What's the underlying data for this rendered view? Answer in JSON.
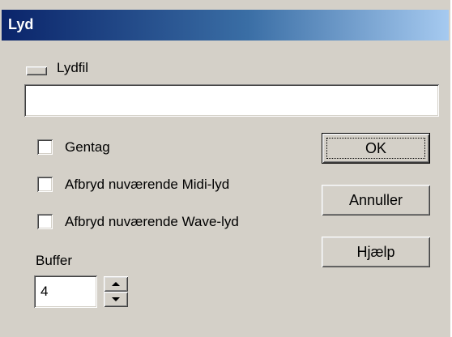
{
  "window": {
    "title": "Lyd"
  },
  "sound_file": {
    "label": "Lydfil",
    "value": "",
    "placeholder": ""
  },
  "options": {
    "repeat": {
      "label": "Gentag",
      "checked": false
    },
    "stop_midi": {
      "label": "Afbryd nuværende Midi-lyd",
      "checked": false
    },
    "stop_wave": {
      "label": "Afbryd nuværende Wave-lyd",
      "checked": false
    }
  },
  "buffer": {
    "label": "Buffer",
    "value": "4"
  },
  "buttons": {
    "ok": "OK",
    "cancel": "Annuller",
    "help": "Hjælp"
  },
  "colors": {
    "face": "#d4d0c8",
    "title_start": "#0a246a",
    "title_end": "#a6caf0",
    "title_text": "#ffffff"
  }
}
